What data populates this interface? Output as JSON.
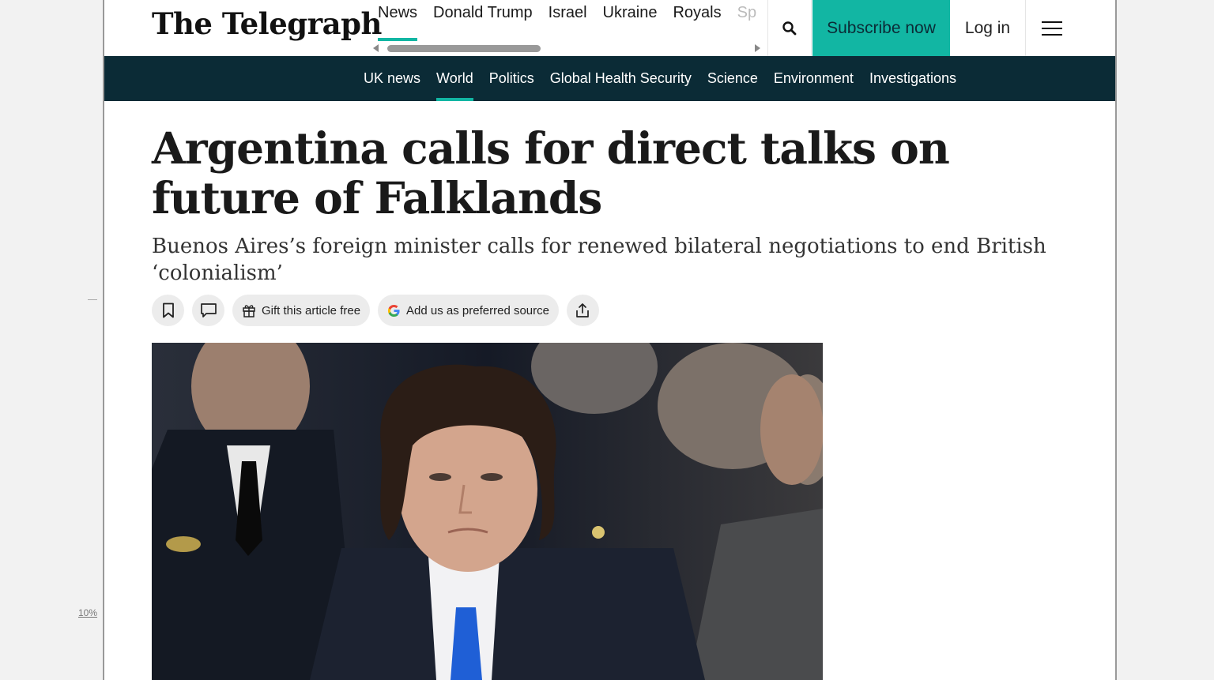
{
  "gutter": {
    "zoom_label": "10%"
  },
  "header": {
    "logo_text": "The Telegraph",
    "topnav": [
      {
        "label": "News",
        "active": true
      },
      {
        "label": "Donald Trump"
      },
      {
        "label": "Israel"
      },
      {
        "label": "Ukraine"
      },
      {
        "label": "Royals"
      },
      {
        "label": "Sp"
      }
    ],
    "search_icon": "search-icon",
    "subscribe_label": "Subscribe now",
    "login_label": "Log in",
    "menu_icon": "hamburger-menu-icon"
  },
  "section_nav": {
    "items": [
      {
        "label": "UK news"
      },
      {
        "label": "World",
        "active": true
      },
      {
        "label": "Politics"
      },
      {
        "label": "Global Health Security"
      },
      {
        "label": "Science"
      },
      {
        "label": "Environment"
      },
      {
        "label": "Investigations"
      }
    ]
  },
  "article": {
    "headline": "Argentina calls for direct talks on future of Falklands",
    "standfirst": "Buenos Aires’s foreign minister calls for renewed bilateral negotiations to end British ‘colonialism’",
    "actions": {
      "bookmark_icon": "bookmark-icon",
      "comment_icon": "comment-icon",
      "gift_label": "Gift this article free",
      "preferred_source_label": "Add us as preferred source",
      "share_icon": "share-icon"
    }
  },
  "colors": {
    "accent": "#12b6a3",
    "section_nav_bg": "#0b2b36",
    "headline": "#1a1a1a"
  }
}
